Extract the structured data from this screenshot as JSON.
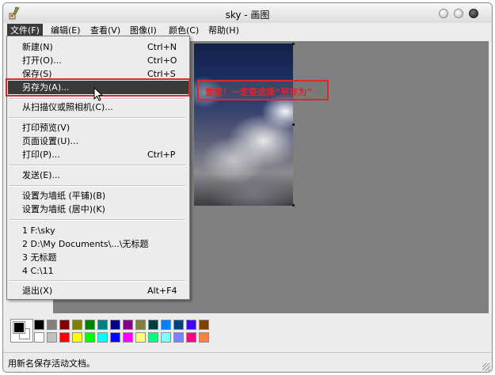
{
  "window": {
    "title": "sky - 画图"
  },
  "menubar": [
    {
      "label": "文件(F)",
      "active": true
    },
    {
      "label": "编辑(E)"
    },
    {
      "label": "查看(V)"
    },
    {
      "label": "图像(I)"
    },
    {
      "label": "颜色(C)"
    },
    {
      "label": "帮助(H)"
    }
  ],
  "file_menu": {
    "items": [
      {
        "label": "新建(N)",
        "shortcut": "Ctrl+N"
      },
      {
        "label": "打开(O)...",
        "shortcut": "Ctrl+O"
      },
      {
        "label": "保存(S)",
        "shortcut": "Ctrl+S"
      },
      {
        "label": "另存为(A)...",
        "shortcut": "",
        "highlighted": true
      },
      {
        "label": "从扫描仪或照相机(C)...",
        "shortcut": ""
      },
      {
        "label": "打印预览(V)",
        "shortcut": ""
      },
      {
        "label": "页面设置(U)...",
        "shortcut": ""
      },
      {
        "label": "打印(P)...",
        "shortcut": "Ctrl+P"
      },
      {
        "label": "发送(E)...",
        "shortcut": ""
      },
      {
        "label": "设置为墙纸 (平铺)(B)",
        "shortcut": ""
      },
      {
        "label": "设置为墙纸 (居中)(K)",
        "shortcut": ""
      },
      {
        "label": "1 F:\\sky",
        "shortcut": ""
      },
      {
        "label": "2 D:\\My Documents\\...\\无标题",
        "shortcut": ""
      },
      {
        "label": "3 无标题",
        "shortcut": ""
      },
      {
        "label": "4 C:\\11",
        "shortcut": ""
      },
      {
        "label": "退出(X)",
        "shortcut": "Alt+F4"
      }
    ]
  },
  "annotation": {
    "text": "重要！一定要选择“另存为”",
    "color": "#e2232a"
  },
  "status": {
    "text": "用新名保存活动文档。"
  },
  "palette": {
    "foreground": "#000000",
    "background": "#ffffff",
    "row1": [
      "#000000",
      "#808080",
      "#800000",
      "#808000",
      "#008000",
      "#008080",
      "#000080",
      "#800080",
      "#808040",
      "#004040",
      "#0080ff",
      "#004080",
      "#4000ff",
      "#804000"
    ],
    "row2": [
      "#ffffff",
      "#c0c0c0",
      "#ff0000",
      "#ffff00",
      "#00ff00",
      "#00ffff",
      "#0000ff",
      "#ff00ff",
      "#ffff80",
      "#00ff80",
      "#80ffff",
      "#8080ff",
      "#ff0080",
      "#ff8040"
    ]
  }
}
